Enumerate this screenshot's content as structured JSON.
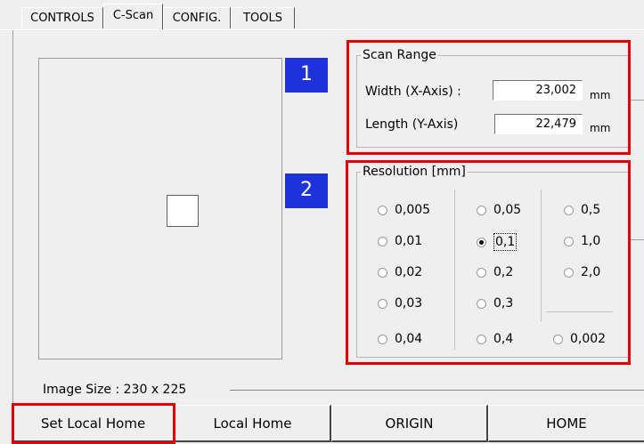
{
  "tabs": [
    {
      "label": "CONTROLS",
      "active": false
    },
    {
      "label": "C-Scan",
      "active": true
    },
    {
      "label": "CONFIG.",
      "active": false
    },
    {
      "label": "TOOLS",
      "active": false
    }
  ],
  "scan_range": {
    "title": "Scan Range",
    "width_label": "Width (X-Axis) :",
    "width_value": "23,002",
    "width_unit": "mm",
    "length_label": "Length (Y-Axis)",
    "length_value": "22,479",
    "length_unit": "mm"
  },
  "resolution": {
    "title": "Resolution [mm]",
    "options": [
      "0,005",
      "0,01",
      "0,02",
      "0,03",
      "0,04",
      "0,05",
      "0,1",
      "0,2",
      "0,3",
      "0,4",
      "0,5",
      "1,0",
      "2,0",
      "0,002"
    ],
    "selected": "0,1"
  },
  "badges": {
    "one": "1",
    "two": "2"
  },
  "image_size": "Image Size :  230 x 225",
  "buttons": {
    "set_local_home": "Set Local Home",
    "local_home": "Local Home",
    "origin": "ORIGIN",
    "home": "HOME"
  },
  "colors": {
    "highlight": "#e60000",
    "badge": "#1e32dc"
  }
}
